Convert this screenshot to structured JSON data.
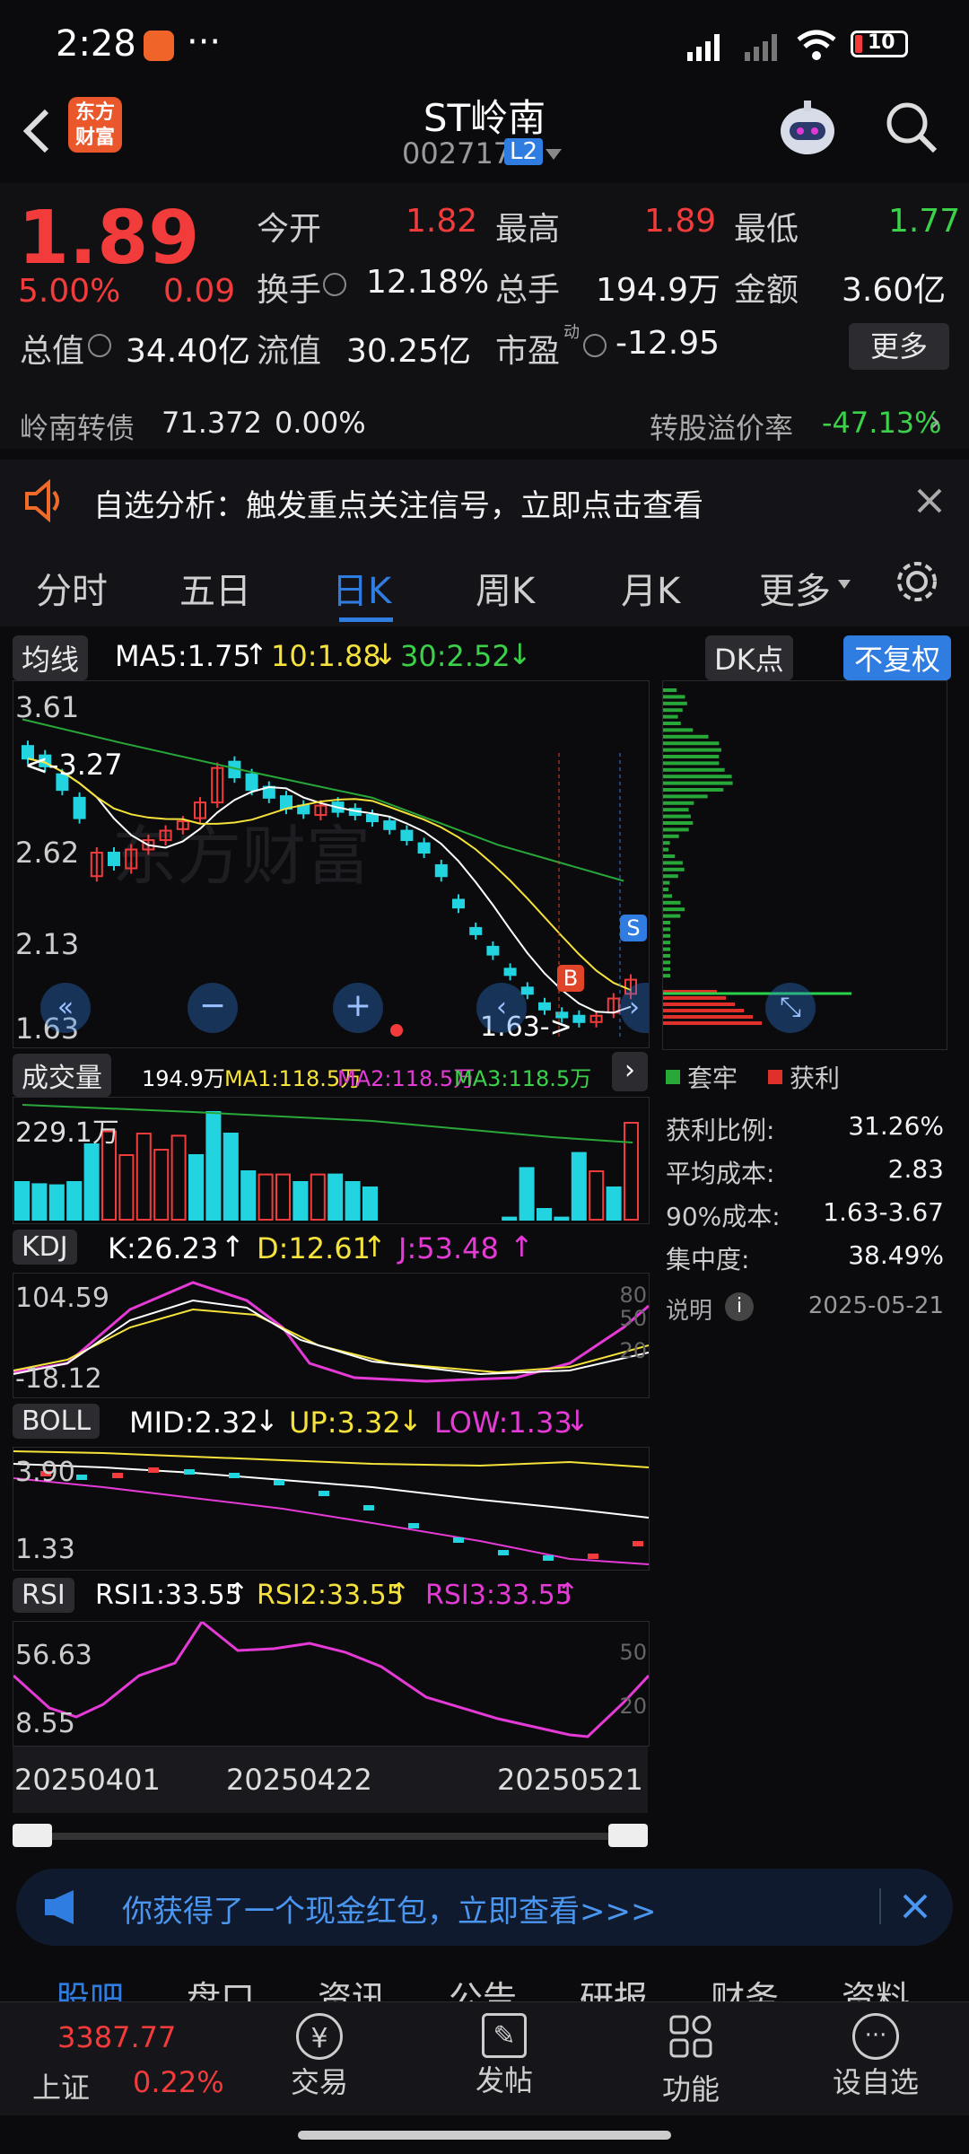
{
  "status_bar": {
    "time": "2:28",
    "dots": "···",
    "battery": "10"
  },
  "header": {
    "logo_text": "东方财富",
    "title": "ST岭南",
    "code": "002717",
    "level_badge": "L2"
  },
  "quote": {
    "price": "1.89",
    "change_pct": "5.00%",
    "change": "0.09",
    "open_label": "今开",
    "open": "1.82",
    "high_label": "最高",
    "high": "1.89",
    "low_label": "最低",
    "low": "1.77",
    "turnover_label": "换手",
    "turnover": "12.18%",
    "volume_label": "总手",
    "volume": "194.9万",
    "amount_label": "金额",
    "amount": "3.60亿",
    "mktcap_label": "总值",
    "mktcap": "34.40亿",
    "float_label": "流值",
    "float": "30.25亿",
    "pe_label": "市盈",
    "pe_sup": "动",
    "pe": "-12.95",
    "more_button": "更多"
  },
  "bond": {
    "name": "岭南转债",
    "price": "71.372",
    "change": "0.00%",
    "premium_label": "转股溢价率",
    "premium": "-47.13%"
  },
  "alert": {
    "text": "自选分析：触发重点关注信号，立即点击查看"
  },
  "tabs": [
    "分时",
    "五日",
    "日K",
    "周K",
    "月K",
    "更多"
  ],
  "active_tab": "日K",
  "ma_bar": {
    "label": "均线",
    "ma5": "MA5:1.75",
    "ma10": "10:1.88",
    "ma30": "30:2.52",
    "dk": "DK点",
    "fq": "不复权"
  },
  "kchart": {
    "y_top": "3.61",
    "y_mid1": "2.62",
    "y_mid2": "2.13",
    "y_bot": "1.63",
    "hi_marker": "<-3.27",
    "lo_marker": "1.63->",
    "sig_s": "S",
    "sig_b": "B",
    "watermark": "东方财富"
  },
  "chip": {
    "legend_trapped": "套牢",
    "legend_profit": "获利",
    "rows": [
      {
        "label": "获利比例:",
        "value": "31.26%"
      },
      {
        "label": "平均成本:",
        "value": "2.83"
      },
      {
        "label": "90%成本:",
        "value": "1.63-3.67"
      },
      {
        "label": "集中度:",
        "value": "38.49%"
      }
    ],
    "note": "说明",
    "date": "2025-05-21"
  },
  "volume": {
    "label": "成交量",
    "v": "194.9万",
    "ma1": "MA1:118.5万",
    "ma2": "MA2:118.5万",
    "ma3": "MA3:118.5万",
    "y_top": "229.1万"
  },
  "kdj": {
    "label": "KDJ",
    "k": "K:26.23",
    "d": "D:12.61",
    "j": "J:53.48",
    "y_top": "104.59",
    "y_bot": "-18.12",
    "r80": "80",
    "r50": "50",
    "r20": "20"
  },
  "boll": {
    "label": "BOLL",
    "mid": "MID:2.32",
    "up": "UP:3.32",
    "low": "LOW:1.33",
    "y_top": "3.90",
    "y_bot": "1.33"
  },
  "rsi": {
    "label": "RSI",
    "r1": "RSI1:33.55",
    "r2": "RSI2:33.55",
    "r3": "RSI3:33.55",
    "y_top": "56.63",
    "y_bot": "8.55",
    "r50": "50",
    "r20": "20"
  },
  "dates": [
    "20250401",
    "20250422",
    "20250521"
  ],
  "banner": {
    "text": "你获得了一个现金红包，立即查看>>>"
  },
  "subtabs": [
    "股吧",
    "盘口",
    "资讯",
    "公告",
    "研报",
    "财务",
    "资料"
  ],
  "bottom": {
    "index_value": "3387.77",
    "index_name": "上证",
    "index_change": "0.22%",
    "trade": "交易",
    "post": "发帖",
    "func": "功能",
    "watch": "设自选"
  },
  "colors": {
    "up": "#f23b3b",
    "down": "#22d3e0",
    "ma5": "#ffffff",
    "ma10": "#f5e23a",
    "ma30": "#29a83a",
    "accent": "#2f7de1"
  }
}
